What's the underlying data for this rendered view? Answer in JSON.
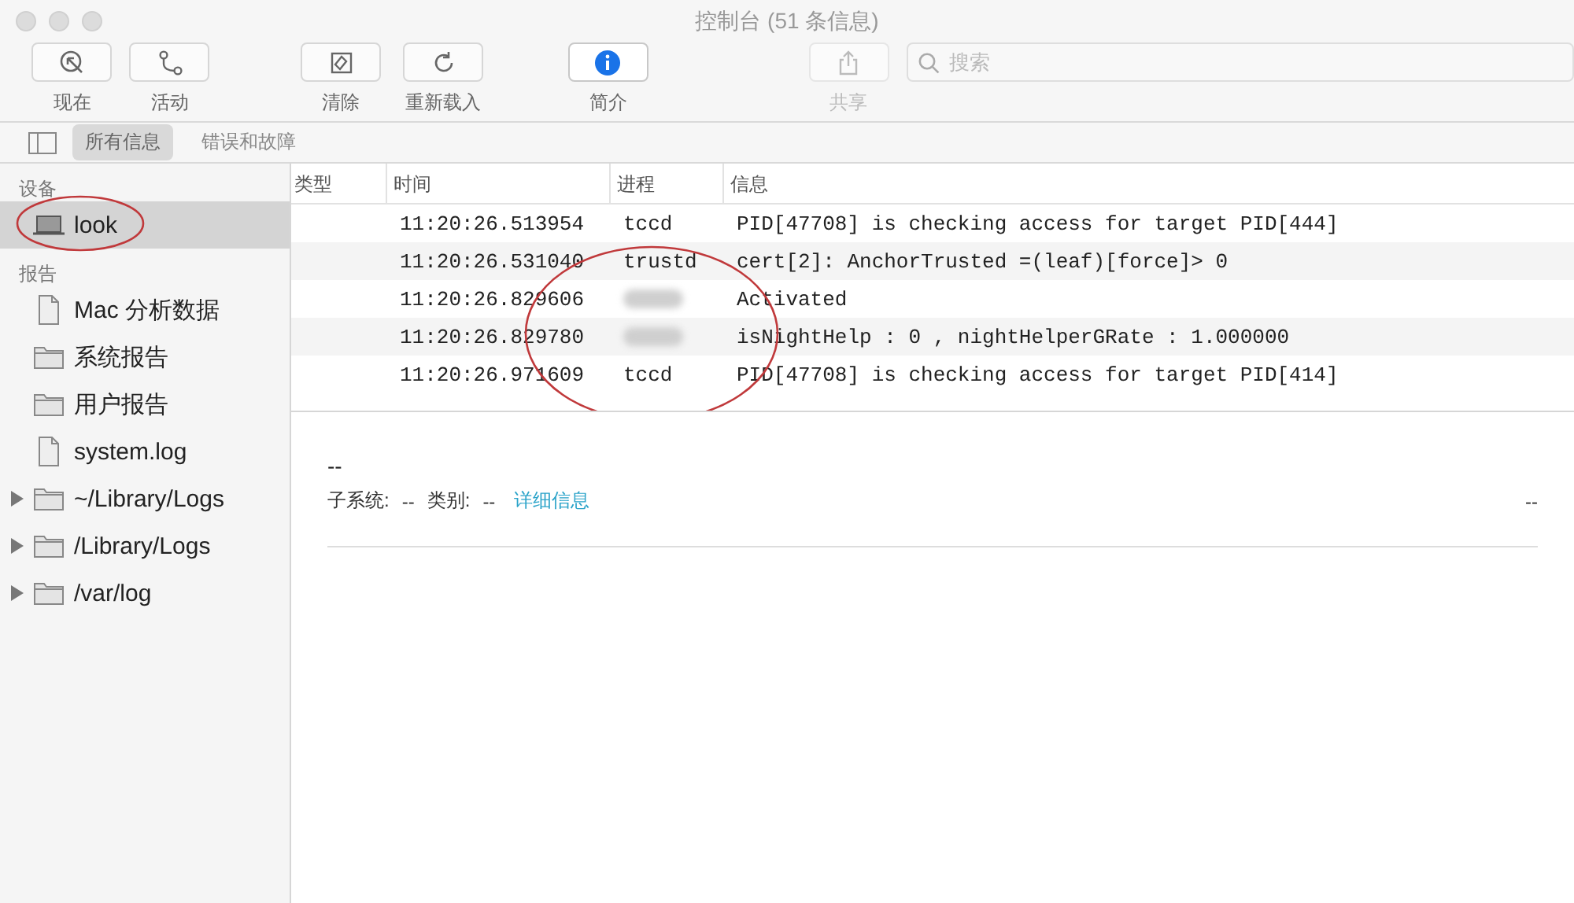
{
  "window": {
    "title": "控制台 (51 条信息)"
  },
  "toolbar": {
    "buttons": [
      {
        "kind": "now",
        "label": "现在",
        "on": false,
        "disabled": false
      },
      {
        "kind": "activity",
        "label": "活动",
        "on": false,
        "disabled": false
      },
      {
        "kind": "clear",
        "label": "清除",
        "on": false,
        "disabled": false
      },
      {
        "kind": "reload",
        "label": "重新载入",
        "on": false,
        "disabled": false
      },
      {
        "kind": "info",
        "label": "简介",
        "on": true,
        "disabled": false
      },
      {
        "kind": "share",
        "label": "共享",
        "on": false,
        "disabled": true
      }
    ],
    "search": {
      "placeholder": "搜索"
    }
  },
  "filter_tabs": [
    {
      "label": "所有信息",
      "selected": true
    },
    {
      "label": "错误和故障",
      "selected": false
    }
  ],
  "sidebar": {
    "sections": [
      {
        "title": "设备",
        "items": [
          {
            "kind": "device",
            "label": "look",
            "selected": true,
            "expandable": false,
            "annotated": true
          }
        ]
      },
      {
        "title": "报告",
        "items": [
          {
            "kind": "document",
            "label": "Mac 分析数据",
            "selected": false,
            "expandable": false,
            "annotated": false
          },
          {
            "kind": "folder",
            "label": "系统报告",
            "selected": false,
            "expandable": false,
            "annotated": false
          },
          {
            "kind": "folder",
            "label": "用户报告",
            "selected": false,
            "expandable": false,
            "annotated": false
          },
          {
            "kind": "document",
            "label": "system.log",
            "selected": false,
            "expandable": false,
            "annotated": false
          },
          {
            "kind": "folder",
            "label": "~/Library/Logs",
            "selected": false,
            "expandable": true,
            "annotated": false
          },
          {
            "kind": "folder",
            "label": "/Library/Logs",
            "selected": false,
            "expandable": true,
            "annotated": false
          },
          {
            "kind": "folder",
            "label": "/var/log",
            "selected": false,
            "expandable": true,
            "annotated": false
          }
        ]
      }
    ]
  },
  "table": {
    "columns": [
      "类型",
      "时间",
      "进程",
      "信息"
    ],
    "rows": [
      {
        "time": "11:20:26.513954",
        "process": "tccd",
        "message": "PID[47708] is checking access for target PID[444]",
        "blurred": false
      },
      {
        "time": "11:20:26.531040",
        "process": "trustd",
        "message": "cert[2]: AnchorTrusted =(leaf)[force]> 0",
        "blurred": false
      },
      {
        "time": "11:20:26.829606",
        "message": "Activated",
        "blurred": true
      },
      {
        "time": "11:20:26.829780",
        "message": "isNightHelp : 0 , nightHelperGRate : 1.000000",
        "blurred": true
      },
      {
        "time": "11:20:26.971609",
        "process": "tccd",
        "message": "PID[47708] is checking access for target PID[414]",
        "blurred": false
      }
    ],
    "annotated": true
  },
  "detail": {
    "title": "--",
    "subsystem_label": "子系统:",
    "subsystem": "--",
    "category_label": "类别:",
    "category": "--",
    "link": "详细信息",
    "right": "--"
  }
}
